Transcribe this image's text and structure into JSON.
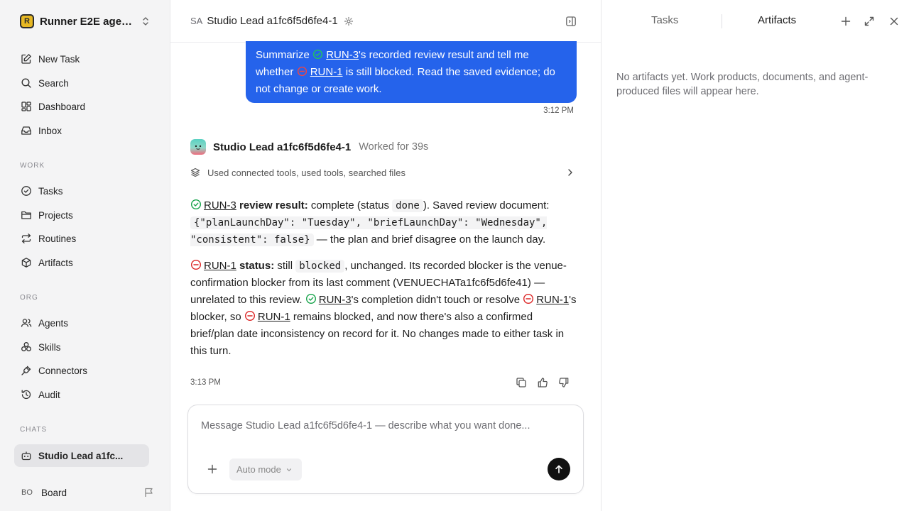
{
  "sidebar": {
    "workspace_name": "Runner E2E agen...",
    "workspace_logo_letter": "R",
    "top_items": [
      {
        "label": "New Task",
        "icon": "edit-icon"
      },
      {
        "label": "Search",
        "icon": "search-icon"
      },
      {
        "label": "Dashboard",
        "icon": "dashboard-icon"
      },
      {
        "label": "Inbox",
        "icon": "inbox-icon"
      }
    ],
    "work_section": "WORK",
    "work_items": [
      {
        "label": "Tasks",
        "icon": "check-circle-icon"
      },
      {
        "label": "Projects",
        "icon": "folder-icon"
      },
      {
        "label": "Routines",
        "icon": "repeat-icon"
      },
      {
        "label": "Artifacts",
        "icon": "cube-icon"
      }
    ],
    "org_section": "ORG",
    "org_items": [
      {
        "label": "Agents",
        "icon": "users-icon"
      },
      {
        "label": "Skills",
        "icon": "skills-icon"
      },
      {
        "label": "Connectors",
        "icon": "plug-icon"
      },
      {
        "label": "Audit",
        "icon": "history-icon"
      }
    ],
    "chats_section": "CHATS",
    "chat_items": [
      {
        "label": "Studio Lead a1fc...",
        "icon": "bot-icon",
        "active": true
      }
    ],
    "user": {
      "initials": "BO",
      "name": "Board"
    }
  },
  "header": {
    "avatar_initials": "SA",
    "title": "Studio Lead a1fc6f5d6fe4-1"
  },
  "user_message": {
    "text_1": "Summarize ",
    "run3": "RUN-3",
    "text_2": "'s recorded review result and tell me whether ",
    "run1": "RUN-1",
    "text_3": " is still blocked. Read the saved evidence; do not change or create work.",
    "time": "3:12 PM"
  },
  "agent_message": {
    "name": "Studio Lead a1fc6f5d6fe4-1",
    "worked": "Worked for 39s",
    "tools_summary": "Used connected tools, used tools, searched files",
    "p1": {
      "run": "RUN-3",
      "bold": " review result:",
      "t1": " complete (status ",
      "code1": "done",
      "t2": "). Saved review document: ",
      "code2": "{\"planLaunchDay\": \"Tuesday\", \"briefLaunchDay\": \"Wednesday\", \"consistent\": false}",
      "t3": " — the plan and brief disagree on the launch day."
    },
    "p2": {
      "run": "RUN-1",
      "bold": " status:",
      "t1": " still ",
      "code1": "blocked",
      "t2": ", unchanged. Its recorded blocker is the venue-confirmation blocker from its last comment (VENUECHATa1fc6f5d6fe41) — unrelated to this review. ",
      "run3": "RUN-3",
      "t3": "'s completion didn't touch or resolve ",
      "run1a": "RUN-1",
      "t4": "'s blocker, so ",
      "run1b": "RUN-1",
      "t5": " remains blocked, and now there's also a confirmed brief/plan date inconsistency on record for it. No changes made to either task in this turn."
    },
    "time": "3:13 PM"
  },
  "composer": {
    "placeholder": "Message Studio Lead a1fc6f5d6fe4-1 — describe what you want done...",
    "mode": "Auto mode"
  },
  "right_panel": {
    "tab_tasks": "Tasks",
    "tab_artifacts": "Artifacts",
    "empty_text": "No artifacts yet. Work products, documents, and agent-produced files will appear here."
  },
  "colors": {
    "accent_blue": "#2563eb",
    "done_green": "#16a34a",
    "blocked_red": "#dc2626"
  }
}
